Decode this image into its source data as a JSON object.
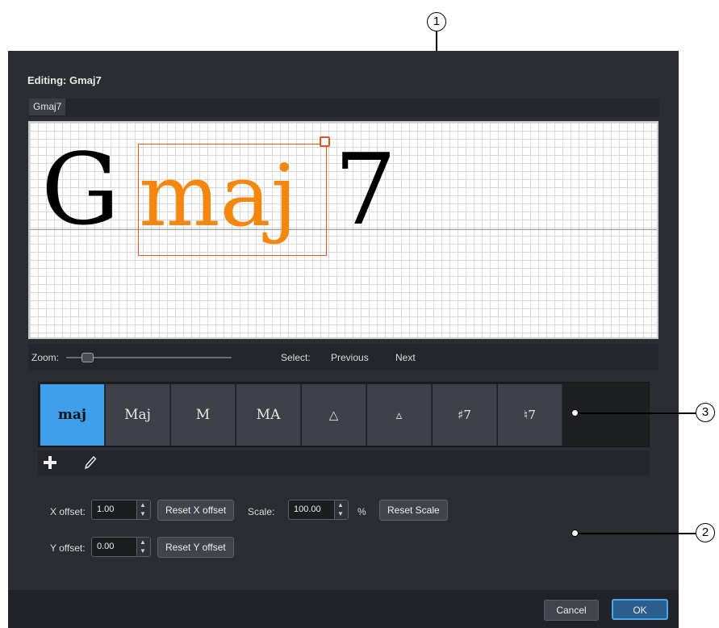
{
  "dialog": {
    "title": "Editing:  Gmaj7",
    "tab_label": "Gmaj7"
  },
  "preview": {
    "root": "G",
    "suffix": "maj",
    "extension": "7",
    "suffix_color": "#f5870f",
    "selection_color": "#e8521c"
  },
  "zoom_bar": {
    "zoom_label": "Zoom:",
    "zoom_level": 0.1,
    "select_label": "Select:",
    "previous_label": "Previous",
    "next_label": "Next"
  },
  "suffix_palette": {
    "selected_color": "#3ea0ec",
    "items": [
      {
        "label": "maj",
        "selected": true
      },
      {
        "label": "Maj",
        "selected": false
      },
      {
        "label": "M",
        "selected": false
      },
      {
        "label": "MA",
        "selected": false
      },
      {
        "label": "△",
        "selected": false
      },
      {
        "label": "▵",
        "selected": false
      },
      {
        "label": "♯7",
        "selected": false
      },
      {
        "label": "♮7",
        "selected": false
      }
    ]
  },
  "tools": {
    "add_icon": "plus-icon",
    "edit_icon": "pencil-icon"
  },
  "properties": {
    "x_offset_label": "X offset:",
    "x_offset_value": "1.00",
    "reset_x_label": "Reset X offset",
    "scale_label": "Scale:",
    "scale_value": "100.00",
    "scale_unit": "%",
    "reset_scale_label": "Reset Scale",
    "y_offset_label": "Y offset:",
    "y_offset_value": "0.00",
    "reset_y_label": "Reset Y offset"
  },
  "footer": {
    "cancel_label": "Cancel",
    "ok_label": "OK"
  },
  "callouts": [
    "1",
    "2",
    "3"
  ]
}
